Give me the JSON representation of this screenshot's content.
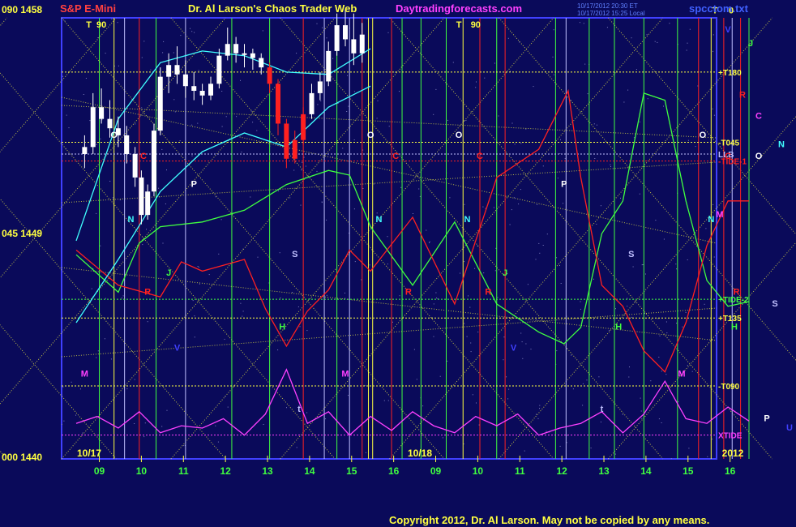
{
  "header": {
    "left_label": "S&P E-Mini",
    "title": "Dr. Al Larson's Chaos Trader Web",
    "site": "Daytradingforecasts.com",
    "file": "spcctom.txt",
    "stamp_line1": "10/17/2012 20:30 ET",
    "stamp_line2": "10/17/2012 15:25 Local"
  },
  "y_labels": [
    {
      "text": "090 1458",
      "price": 1458
    },
    {
      "text": "045 1449",
      "price": 1449
    },
    {
      "text": "000 1440",
      "price": 1440
    }
  ],
  "footer": "Copyright 2012, Dr. Al Larson. May not be copied by any means.",
  "colors": {
    "background": "#0a0a5a",
    "plot_border": "#4040ff",
    "yellow": "#ffff40",
    "green": "#40ff40",
    "red": "#ff2020",
    "cyan": "#40ffff",
    "magenta": "#ff40ff",
    "white": "#ffffff",
    "lavender": "#c0c0ff",
    "copper": "#ff8040",
    "blue": "#4040ff"
  },
  "chart_data": {
    "type": "line",
    "title": "S&P E-Mini",
    "x_axis": {
      "hour_ticks": [
        "09",
        "10",
        "11",
        "12",
        "13",
        "14",
        "15",
        "16",
        "09",
        "10",
        "11",
        "12",
        "13",
        "14",
        "15",
        "16"
      ],
      "date_labels": [
        "10/17",
        "10/18",
        "2012"
      ]
    },
    "y_axis": {
      "price_range": [
        1440,
        1458
      ],
      "angle_labels": [
        "090",
        "045",
        "000"
      ]
    },
    "price_bars": [
      {
        "t": 0.2,
        "o": 1452.6,
        "h": 1453.4,
        "l": 1452.0,
        "c": 1452.9
      },
      {
        "t": 0.4,
        "o": 1452.9,
        "h": 1455.2,
        "l": 1452.6,
        "c": 1454.6
      },
      {
        "t": 0.6,
        "o": 1454.6,
        "h": 1455.4,
        "l": 1453.9,
        "c": 1454.1
      },
      {
        "t": 0.8,
        "o": 1454.1,
        "h": 1454.9,
        "l": 1453.3,
        "c": 1453.7
      },
      {
        "t": 1.0,
        "o": 1453.7,
        "h": 1454.2,
        "l": 1452.9,
        "c": 1453.4
      },
      {
        "t": 1.2,
        "o": 1453.4,
        "h": 1453.8,
        "l": 1452.2,
        "c": 1452.6
      },
      {
        "t": 1.4,
        "o": 1452.6,
        "h": 1452.9,
        "l": 1451.2,
        "c": 1451.6
      },
      {
        "t": 1.55,
        "o": 1451.6,
        "h": 1451.9,
        "l": 1449.6,
        "c": 1450.0
      },
      {
        "t": 1.7,
        "o": 1450.0,
        "h": 1451.3,
        "l": 1449.8,
        "c": 1451.0
      },
      {
        "t": 1.85,
        "o": 1451.0,
        "h": 1453.9,
        "l": 1450.8,
        "c": 1453.6
      },
      {
        "t": 2.0,
        "o": 1453.6,
        "h": 1456.3,
        "l": 1453.4,
        "c": 1455.9
      },
      {
        "t": 2.2,
        "o": 1455.9,
        "h": 1456.9,
        "l": 1455.2,
        "c": 1456.4
      },
      {
        "t": 2.4,
        "o": 1456.4,
        "h": 1457.2,
        "l": 1455.6,
        "c": 1456.0
      },
      {
        "t": 2.6,
        "o": 1456.0,
        "h": 1456.6,
        "l": 1455.0,
        "c": 1455.5
      },
      {
        "t": 2.8,
        "o": 1455.5,
        "h": 1456.1,
        "l": 1454.9,
        "c": 1455.3
      },
      {
        "t": 3.0,
        "o": 1455.3,
        "h": 1455.6,
        "l": 1454.7,
        "c": 1455.1
      },
      {
        "t": 3.2,
        "o": 1455.1,
        "h": 1455.9,
        "l": 1454.9,
        "c": 1455.6
      },
      {
        "t": 3.4,
        "o": 1455.6,
        "h": 1457.1,
        "l": 1455.4,
        "c": 1456.8
      },
      {
        "t": 3.6,
        "o": 1456.8,
        "h": 1458.0,
        "l": 1456.6,
        "c": 1457.3
      },
      {
        "t": 3.8,
        "o": 1457.3,
        "h": 1457.6,
        "l": 1456.5,
        "c": 1456.9
      },
      {
        "t": 4.0,
        "o": 1456.9,
        "h": 1457.3,
        "l": 1456.3,
        "c": 1456.9
      },
      {
        "t": 4.2,
        "o": 1456.9,
        "h": 1457.1,
        "l": 1456.2,
        "c": 1456.7
      },
      {
        "t": 4.4,
        "o": 1456.7,
        "h": 1456.9,
        "l": 1456.0,
        "c": 1456.3
      },
      {
        "t": 4.6,
        "o": 1456.3,
        "h": 1456.5,
        "l": 1455.2,
        "c": 1455.6
      },
      {
        "t": 4.8,
        "o": 1455.6,
        "h": 1455.8,
        "l": 1453.4,
        "c": 1453.9
      },
      {
        "t": 5.0,
        "o": 1453.9,
        "h": 1454.1,
        "l": 1452.0,
        "c": 1452.4
      },
      {
        "t": 5.2,
        "o": 1452.4,
        "h": 1453.6,
        "l": 1452.2,
        "c": 1453.2
      },
      {
        "t": 5.4,
        "o": 1453.2,
        "h": 1454.6,
        "l": 1453.0,
        "c": 1454.3
      },
      {
        "t": 5.6,
        "o": 1454.3,
        "h": 1455.6,
        "l": 1454.1,
        "c": 1455.2
      },
      {
        "t": 5.8,
        "o": 1455.2,
        "h": 1456.1,
        "l": 1454.9,
        "c": 1455.7
      },
      {
        "t": 6.0,
        "o": 1455.7,
        "h": 1457.4,
        "l": 1455.5,
        "c": 1457.0
      },
      {
        "t": 6.2,
        "o": 1457.0,
        "h": 1458.6,
        "l": 1456.8,
        "c": 1458.1
      },
      {
        "t": 6.4,
        "o": 1458.1,
        "h": 1458.8,
        "l": 1457.2,
        "c": 1457.5
      },
      {
        "t": 6.6,
        "o": 1457.5,
        "h": 1458.6,
        "l": 1456.4,
        "c": 1456.9
      },
      {
        "t": 6.8,
        "o": 1456.9,
        "h": 1458.2,
        "l": 1456.5,
        "c": 1457.7
      }
    ],
    "wave_series": [
      {
        "name": "green wave",
        "color": "#40ff40",
        "points": [
          [
            0,
            1448.3
          ],
          [
            1,
            1446.7
          ],
          [
            1.5,
            1448.8
          ],
          [
            2,
            1449.5
          ],
          [
            3,
            1449.7
          ],
          [
            4,
            1450.2
          ],
          [
            5,
            1451.3
          ],
          [
            6,
            1451.9
          ],
          [
            6.5,
            1451.7
          ],
          [
            7,
            1449.5
          ],
          [
            8,
            1447.0
          ],
          [
            9,
            1449.7
          ],
          [
            10,
            1446.2
          ],
          [
            11,
            1445.0
          ],
          [
            11.6,
            1444.5
          ],
          [
            12,
            1445.2
          ],
          [
            12.5,
            1449.2
          ],
          [
            13,
            1450.6
          ],
          [
            13.5,
            1455.2
          ],
          [
            14,
            1454.9
          ],
          [
            14.5,
            1450.6
          ],
          [
            15,
            1447.2
          ],
          [
            15.5,
            1446.1
          ],
          [
            16,
            1446.3
          ]
        ]
      },
      {
        "name": "red wave",
        "color": "#ff2020",
        "points": [
          [
            0,
            1448.5
          ],
          [
            1,
            1447.0
          ],
          [
            2,
            1446.5
          ],
          [
            2.5,
            1448.0
          ],
          [
            3,
            1447.6
          ],
          [
            4,
            1448.1
          ],
          [
            4.5,
            1446.0
          ],
          [
            5,
            1444.4
          ],
          [
            5.5,
            1445.9
          ],
          [
            6,
            1446.8
          ],
          [
            6.5,
            1448.5
          ],
          [
            7,
            1447.6
          ],
          [
            8,
            1449.9
          ],
          [
            9,
            1446.2
          ],
          [
            10,
            1451.6
          ],
          [
            11,
            1452.8
          ],
          [
            11.7,
            1455.3
          ],
          [
            12,
            1451.6
          ],
          [
            12.5,
            1447.0
          ],
          [
            13,
            1446.1
          ],
          [
            13.5,
            1444.2
          ],
          [
            14,
            1443.3
          ],
          [
            14.5,
            1445.4
          ],
          [
            15,
            1448.7
          ],
          [
            15.5,
            1450.6
          ],
          [
            16,
            1450.6
          ]
        ]
      },
      {
        "name": "cyan channel upper",
        "color": "#40ffff",
        "points": [
          [
            0,
            1448.9
          ],
          [
            1,
            1454.1
          ],
          [
            2,
            1456.5
          ],
          [
            3,
            1457.0
          ],
          [
            4,
            1456.8
          ],
          [
            5,
            1456.1
          ],
          [
            6,
            1456.0
          ],
          [
            7,
            1457.1
          ]
        ]
      },
      {
        "name": "cyan channel lower",
        "color": "#40ffff",
        "points": [
          [
            0,
            1445.4
          ],
          [
            1,
            1448.1
          ],
          [
            2,
            1451.0
          ],
          [
            3,
            1452.7
          ],
          [
            4,
            1453.5
          ],
          [
            5,
            1452.9
          ],
          [
            6,
            1454.6
          ],
          [
            7,
            1455.5
          ]
        ]
      },
      {
        "name": "magenta xtide",
        "color": "#ff40ff",
        "points": [
          [
            0,
            1441.1
          ],
          [
            0.5,
            1441.4
          ],
          [
            1,
            1440.9
          ],
          [
            1.5,
            1441.6
          ],
          [
            2,
            1440.7
          ],
          [
            2.5,
            1441.0
          ],
          [
            3,
            1440.9
          ],
          [
            3.5,
            1441.3
          ],
          [
            4,
            1440.6
          ],
          [
            4.5,
            1441.5
          ],
          [
            5,
            1443.4
          ],
          [
            5.5,
            1441.1
          ],
          [
            6,
            1441.6
          ],
          [
            6.5,
            1440.6
          ],
          [
            7,
            1441.4
          ],
          [
            7.5,
            1440.8
          ],
          [
            8,
            1441.6
          ],
          [
            8.5,
            1441.0
          ],
          [
            9,
            1440.7
          ],
          [
            9.5,
            1441.4
          ],
          [
            10,
            1441.0
          ],
          [
            10.5,
            1441.5
          ],
          [
            11,
            1440.6
          ],
          [
            11.5,
            1440.9
          ],
          [
            12,
            1441.1
          ],
          [
            12.5,
            1441.6
          ],
          [
            13,
            1440.7
          ],
          [
            13.5,
            1441.5
          ],
          [
            14,
            1442.9
          ],
          [
            14.5,
            1441.3
          ],
          [
            15,
            1441.1
          ],
          [
            15.5,
            1441.8
          ],
          [
            16,
            1441.2
          ]
        ]
      }
    ],
    "level_lines": [
      {
        "label": "+T180",
        "color": "#ffff40",
        "price": 1456.1
      },
      {
        "label": "-T045",
        "color": "#ffff40",
        "price": 1453.1
      },
      {
        "label": "LLB",
        "color": "#c0c0ff",
        "price": 1452.6
      },
      {
        "label": "-TIDE-1",
        "color": "#ff2020",
        "price": 1452.3
      },
      {
        "label": "+TIDE-2",
        "color": "#40ff40",
        "price": 1446.4
      },
      {
        "label": "+T135",
        "color": "#ffff40",
        "price": 1445.6
      },
      {
        "label": "-T090",
        "color": "#ffff40",
        "price": 1442.7
      },
      {
        "label": "XTIDE",
        "color": "#ff40ff",
        "price": 1440.6
      }
    ],
    "right_markers": [
      {
        "text": "T",
        "color": "#ffff40",
        "price": 1458.6
      },
      {
        "text": "0",
        "color": "#ffff40",
        "price": 1458.6
      },
      {
        "text": "V",
        "color": "#4040ff",
        "price": 1457.8
      },
      {
        "text": "J",
        "color": "#40ff40",
        "price": 1457.2
      },
      {
        "text": "R",
        "color": "#ff2020",
        "price": 1455.0
      },
      {
        "text": "C",
        "color": "#ff40ff",
        "price": 1454.1
      },
      {
        "text": "N",
        "color": "#40ffff",
        "price": 1452.9
      },
      {
        "text": "O",
        "color": "#ffffff",
        "price": 1452.4
      },
      {
        "text": "M",
        "color": "#ff40ff",
        "price": 1449.9
      },
      {
        "text": "S",
        "color": "#c0c0ff",
        "price": 1446.1
      },
      {
        "text": "H",
        "color": "#40ff40",
        "price": 1445.1
      },
      {
        "text": "P",
        "color": "#ffffff",
        "price": 1441.2
      },
      {
        "text": "U",
        "color": "#4040ff",
        "price": 1440.8
      }
    ],
    "in_chart_markers": [
      {
        "text": "T",
        "color": "#ffff40",
        "t": 0.3,
        "price": 1458.0
      },
      {
        "text": "90",
        "color": "#ffff40",
        "t": 0.6,
        "price": 1458.0
      },
      {
        "text": "O",
        "color": "#ffffff",
        "t": 0.9,
        "price": 1453.3
      },
      {
        "text": "C",
        "color": "#ff2020",
        "t": 1.6,
        "price": 1452.4
      },
      {
        "text": "N",
        "color": "#40ffff",
        "t": 1.3,
        "price": 1449.7
      },
      {
        "text": "P",
        "color": "#ffffff",
        "t": 2.8,
        "price": 1451.2
      },
      {
        "text": "J",
        "color": "#40ff40",
        "t": 2.2,
        "price": 1447.4
      },
      {
        "text": "R",
        "color": "#ff2020",
        "t": 1.7,
        "price": 1446.6
      },
      {
        "text": "V",
        "color": "#4040ff",
        "t": 2.4,
        "price": 1444.2
      },
      {
        "text": "M",
        "color": "#ff40ff",
        "t": 0.2,
        "price": 1443.1
      },
      {
        "text": "S",
        "color": "#c0c0ff",
        "t": 5.2,
        "price": 1448.2
      },
      {
        "text": "H",
        "color": "#40ff40",
        "t": 4.9,
        "price": 1445.1
      },
      {
        "text": "M",
        "color": "#ff40ff",
        "t": 6.4,
        "price": 1443.1
      },
      {
        "text": "t",
        "color": "#c0c0ff",
        "t": 5.3,
        "price": 1441.6
      },
      {
        "text": "O",
        "color": "#ffffff",
        "t": 7.0,
        "price": 1453.3
      },
      {
        "text": "N",
        "color": "#40ffff",
        "t": 7.2,
        "price": 1449.7
      },
      {
        "text": "C",
        "color": "#ff2020",
        "t": 7.6,
        "price": 1452.4
      },
      {
        "text": "R",
        "color": "#ff2020",
        "t": 7.9,
        "price": 1446.6
      },
      {
        "text": "T",
        "color": "#ffff40",
        "t": 9.1,
        "price": 1458.0
      },
      {
        "text": "90",
        "color": "#ffff40",
        "t": 9.5,
        "price": 1458.0
      },
      {
        "text": "O",
        "color": "#ffffff",
        "t": 9.1,
        "price": 1453.3
      },
      {
        "text": "N",
        "color": "#40ffff",
        "t": 9.3,
        "price": 1449.7
      },
      {
        "text": "C",
        "color": "#ff2020",
        "t": 9.6,
        "price": 1452.4
      },
      {
        "text": "J",
        "color": "#40ff40",
        "t": 10.2,
        "price": 1447.4
      },
      {
        "text": "R",
        "color": "#ff2020",
        "t": 9.8,
        "price": 1446.6
      },
      {
        "text": "V",
        "color": "#4040ff",
        "t": 10.4,
        "price": 1444.2
      },
      {
        "text": "P",
        "color": "#ffffff",
        "t": 11.6,
        "price": 1451.2
      },
      {
        "text": "S",
        "color": "#c0c0ff",
        "t": 13.2,
        "price": 1448.2
      },
      {
        "text": "H",
        "color": "#40ff40",
        "t": 12.9,
        "price": 1445.1
      },
      {
        "text": "t",
        "color": "#c0c0ff",
        "t": 12.5,
        "price": 1441.6
      },
      {
        "text": "M",
        "color": "#ff40ff",
        "t": 14.4,
        "price": 1443.1
      },
      {
        "text": "O",
        "color": "#ffffff",
        "t": 14.9,
        "price": 1453.3
      },
      {
        "text": "N",
        "color": "#40ffff",
        "t": 15.1,
        "price": 1449.7
      },
      {
        "text": "C",
        "color": "#ff2020",
        "t": 15.5,
        "price": 1452.4
      },
      {
        "text": "R",
        "color": "#ff2020",
        "t": 15.7,
        "price": 1446.6
      }
    ]
  }
}
